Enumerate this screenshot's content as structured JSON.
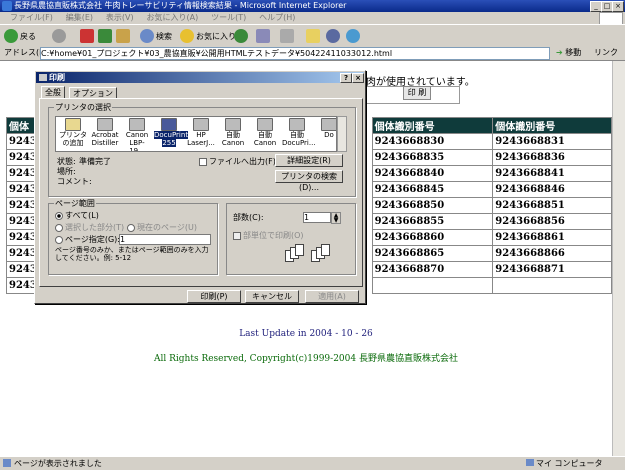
{
  "window": {
    "title": "長野県農協直販株式会社 牛肉トレーサビリティ情報検索結果 - Microsoft Internet Explorer"
  },
  "menu": [
    "ファイル(F)",
    "編集(E)",
    "表示(V)",
    "お気に入り(A)",
    "ツール(T)",
    "ヘルプ(H)"
  ],
  "toolbar": {
    "back": "戻る",
    "search": "検索",
    "favorites": "お気に入り"
  },
  "address": {
    "label": "アドレス(D)",
    "url": "C:¥home¥01_プロジェクト¥03_農協直販¥公開用HTMLテストデータ¥50422411033012.html",
    "go": "移動",
    "links": "リンク"
  },
  "page": {
    "notice": "肉が使用されています。",
    "print_button": "印 刷",
    "column_header": "個体識別番号",
    "col1_prefix": "9243",
    "rows": [
      [
        "9243668830",
        "9243668831"
      ],
      [
        "9243668835",
        "9243668836"
      ],
      [
        "9243668840",
        "9243668841"
      ],
      [
        "9243668845",
        "9243668846"
      ],
      [
        "9243668850",
        "9243668851"
      ],
      [
        "9243668855",
        "9243668856"
      ],
      [
        "9243668860",
        "9243668861"
      ],
      [
        "9243668865",
        "9243668866"
      ],
      [
        "9243668870",
        "9243668871"
      ]
    ],
    "last_update": "Last Update in 2004 - 10 - 26",
    "copyright": "All Rights Reserved, Copyright(c)1999-2004 長野県農協直販株式会社"
  },
  "dialog": {
    "title": "印刷",
    "tabs": [
      "全般",
      "オプション"
    ],
    "printer_group": "プリンタの選択",
    "printers": [
      "プリンタの追加",
      "Acrobat Distiller",
      "Canon LBP-19...",
      "DocuPrint 255",
      "HP LaserJ...",
      "自動 Canon ...",
      "自動 Canon ...",
      "自動 DocuPri...",
      "Do"
    ],
    "status_label": "状態:",
    "status_value": "準備完了",
    "location_label": "場所:",
    "comment_label": "コメント:",
    "print_to_file": "ファイルへ出力(F)",
    "preferences": "詳細設定(R)",
    "find_printer": "プリンタの検索(D)...",
    "range_group": "ページ範囲",
    "all": "すべて(L)",
    "selection": "選択した部分(T)",
    "current_page": "現在のページ(U)",
    "pages": "ページ指定(G):",
    "pages_value": "1",
    "pages_hint": "ページ番号のみか、またはページ範囲のみを入力してください。例: 5-12",
    "copies_label": "部数(C):",
    "copies_value": "1",
    "collate": "部単位で印刷(O)",
    "print": "印刷(P)",
    "cancel": "キャンセル",
    "apply": "適用(A)"
  },
  "status": {
    "text": "ページが表示されました",
    "zone": "マイ コンピュータ"
  }
}
